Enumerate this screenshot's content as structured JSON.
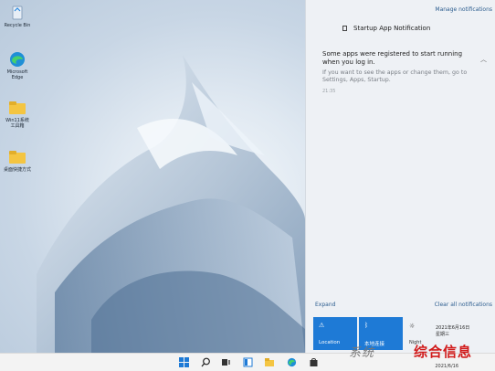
{
  "desktop": {
    "icons": [
      {
        "label": "Recycle Bin",
        "icon": "recycle-bin-icon"
      },
      {
        "label": "Microsoft Edge",
        "icon": "edge-icon"
      },
      {
        "label": "Win11系统\n工具箱",
        "icon": "folder-icon"
      },
      {
        "label": "桌面快捷方式",
        "icon": "folder-icon"
      }
    ]
  },
  "notifications": {
    "manage_label": "Manage notifications",
    "title": "Startup App Notification",
    "message": "Some apps were registered to start running when you log in.",
    "sub": "If you want to see the apps or change them, go to Settings, Apps, Startup.",
    "time": "21:35",
    "expand_label": "Expand",
    "clear_label": "Clear all notifications"
  },
  "quick_actions": [
    {
      "label": "Location",
      "icon": "location-icon",
      "active": true
    },
    {
      "label": "本地连接",
      "icon": "bluetooth-icon",
      "active": true
    },
    {
      "label": "Night",
      "icon": "night-light-icon",
      "active": false
    }
  ],
  "clock": {
    "date_line": "2021年6月16日",
    "weekday": "星期三",
    "taskbar_date": "2021/6/16"
  },
  "taskbar": {
    "icons": [
      "start-icon",
      "search-icon",
      "task-view-icon",
      "widgets-icon",
      "file-explorer-icon",
      "edge-icon",
      "store-icon"
    ]
  },
  "watermark": {
    "left": "系统",
    "right": "综合信息"
  },
  "colors": {
    "accent": "#1e7ad6",
    "watermark_red": "#d11b1b"
  }
}
